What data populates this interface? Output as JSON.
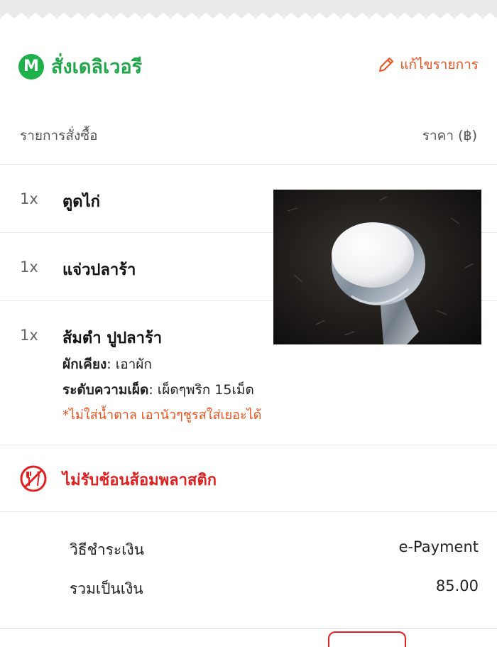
{
  "header": {
    "brand_icon_letter": "M",
    "title": "สั่งเดลิเวอรี",
    "edit_label": "แก้ไขรายการ"
  },
  "list_header": {
    "items_label": "รายการสั่งซื้อ",
    "price_label": "ราคา (฿)"
  },
  "items": [
    {
      "qty": "1x",
      "name": "ตูดไก่"
    },
    {
      "qty": "1x",
      "name": "แจ่วปลาร้า"
    },
    {
      "qty": "1x",
      "name": "ส้มตำ ปูปลาร้า",
      "options": [
        {
          "label": "ผักเคียง",
          "value": ": เอาผัก"
        },
        {
          "label": "ระดับความเผ็ด",
          "value": ": เผ็ดๆพริก 15เม็ด"
        }
      ],
      "note": "*ไม่ใส่น้ำตาล เอานัวๆชูรสใส่เยอะได้"
    }
  ],
  "no_plastic": {
    "label": "ไม่รับช้อนส้อมพลาสติก",
    "icon": "no-cutlery-icon"
  },
  "payment": {
    "method_label": "วิธีชำระเงิน",
    "method_value": "e-Payment",
    "total_label": "รวมเป็นเงิน",
    "total_value": "85.00"
  },
  "colors": {
    "brand_green": "#1fa649",
    "accent_orange": "#e8531f",
    "alert_red": "#e02020"
  }
}
